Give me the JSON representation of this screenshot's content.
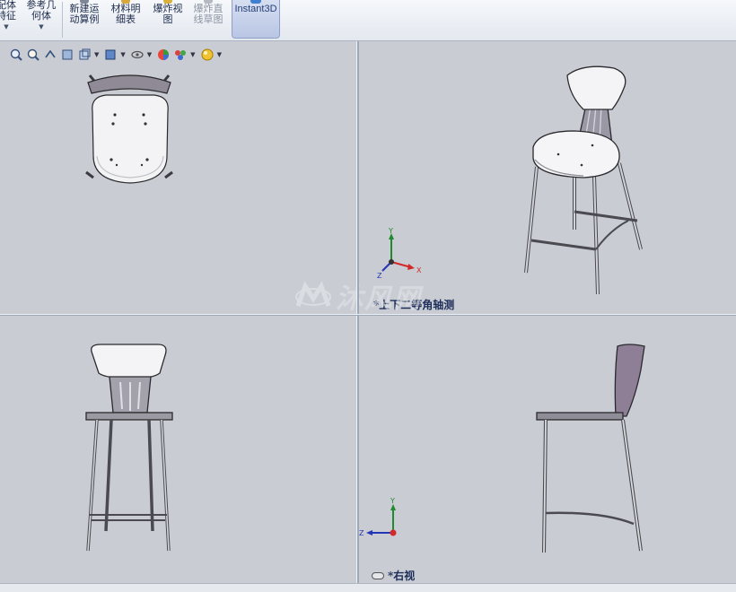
{
  "ribbon": {
    "items": [
      {
        "label": "配体\n特征",
        "has_dropdown": true,
        "enabled": true
      },
      {
        "label": "参考几\n何体",
        "has_dropdown": true,
        "enabled": true
      },
      {
        "label": "新建运\n动算例",
        "has_dropdown": false,
        "enabled": true
      },
      {
        "label": "材料明\n细表",
        "has_dropdown": false,
        "enabled": true
      },
      {
        "label": "爆炸视\n图",
        "has_dropdown": false,
        "enabled": true
      },
      {
        "label": "爆炸直\n线草图",
        "has_dropdown": false,
        "enabled": false
      },
      {
        "label": "Instant3D",
        "has_dropdown": false,
        "enabled": true,
        "active": true
      }
    ]
  },
  "hud_toolbar": {
    "icons": [
      "zoom-to-fit-icon",
      "zoom-to-area-icon",
      "previous-view-icon",
      "section-view-icon",
      "view-orientation-icon",
      "display-style-icon",
      "hide-show-items-icon",
      "edit-appearance-icon",
      "apply-scene-icon",
      "view-settings-icon"
    ]
  },
  "viewports": {
    "top_left": {
      "name": "top-view",
      "label": ""
    },
    "top_right": {
      "name": "isometric-view",
      "label": "*上下二等角轴测"
    },
    "bottom_left": {
      "name": "front-view",
      "label": ""
    },
    "bottom_right": {
      "name": "right-view",
      "label": "*右视"
    }
  },
  "triads": {
    "iso": {
      "x": "X",
      "y": "Y",
      "z": "Z"
    },
    "right": {
      "y": "Y",
      "z": "Z"
    }
  },
  "watermark": {
    "text": "沐风网"
  },
  "colors": {
    "background": "#c9ccd2",
    "axis_x": "#d22a2a",
    "axis_y": "#1f8a2e",
    "axis_z": "#2435b5",
    "active_tool": "#b9c6e4"
  }
}
